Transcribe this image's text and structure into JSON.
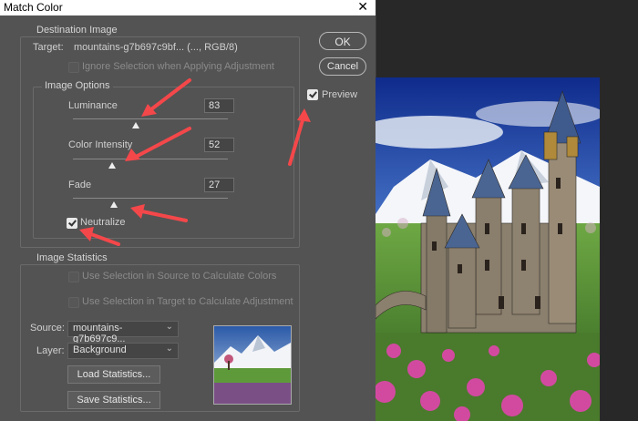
{
  "window": {
    "title": "Match Color",
    "close_glyph": "✕"
  },
  "destination": {
    "legend": "Destination Image",
    "target_label": "Target:",
    "target_value": "mountains-g7b697c9bf... (..., RGB/8)",
    "ignore_selection": {
      "label": "Ignore Selection when Applying Adjustment",
      "checked": false,
      "enabled": false
    }
  },
  "image_options": {
    "legend": "Image Options",
    "luminance": {
      "label": "Luminance",
      "value": "83"
    },
    "color_intensity": {
      "label": "Color Intensity",
      "value": "52"
    },
    "fade": {
      "label": "Fade",
      "value": "27"
    },
    "neutralize": {
      "label": "Neutralize",
      "checked": true
    }
  },
  "buttons": {
    "ok": "OK",
    "cancel": "Cancel"
  },
  "preview": {
    "label": "Preview",
    "checked": true
  },
  "image_statistics": {
    "legend": "Image Statistics",
    "use_source": {
      "label": "Use Selection in Source to Calculate Colors",
      "checked": false
    },
    "use_target": {
      "label": "Use Selection in Target to Calculate Adjustment",
      "checked": false
    },
    "source_label": "Source:",
    "source_value": "mountains-g7b697c9...",
    "layer_label": "Layer:",
    "layer_value": "Background",
    "load_button": "Load Statistics...",
    "save_button": "Save Statistics..."
  },
  "icons": {
    "close": "close-icon",
    "chevron": "chevron-down-icon",
    "arrow": "red-annotation-arrow"
  },
  "colors": {
    "arrow": "#f4474a",
    "dialog_bg": "#535353",
    "canvas_bg": "#282828"
  }
}
